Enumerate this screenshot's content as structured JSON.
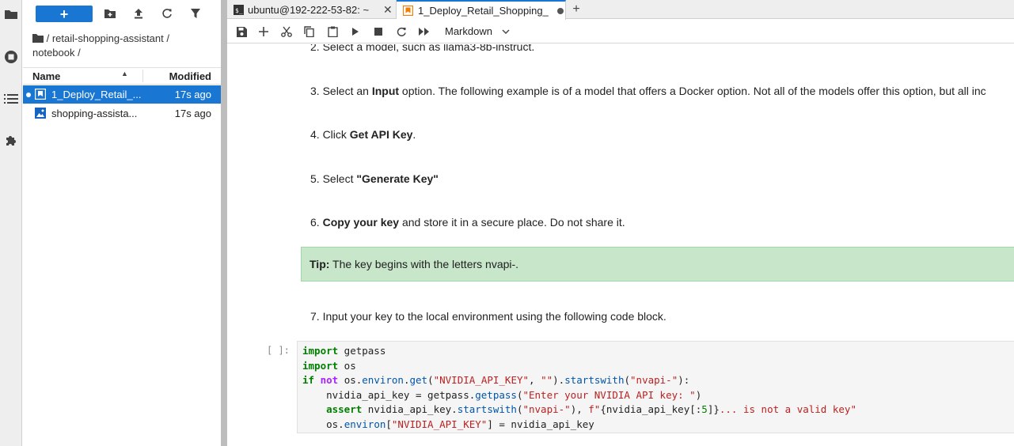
{
  "file_browser": {
    "new_button": "+",
    "breadcrumb": "/ retail-shopping-assistant / notebook /",
    "columns": {
      "name": "Name",
      "modified": "Modified"
    },
    "files": [
      {
        "name": "1_Deploy_Retail_...",
        "modified": "17s ago",
        "icon": "notebook-icon",
        "selected": true
      },
      {
        "name": "shopping-assista...",
        "modified": "17s ago",
        "icon": "image-file-icon",
        "selected": false
      }
    ]
  },
  "tabs": [
    {
      "label": "ubuntu@192-222-53-82: ~",
      "icon": "terminal-icon"
    },
    {
      "label": "1_Deploy_Retail_Shopping_",
      "icon": "notebook-icon",
      "active": true,
      "modified": true
    }
  ],
  "notebook_toolbar": {
    "cell_type": "Markdown"
  },
  "cells": {
    "step2": "2. Select a model, such as llama3-8b-instruct.",
    "step3_pre": "3. Select an ",
    "step3_bold": "Input",
    "step3_post": " option. The following example is of a model that offers a Docker option. Not all of the models offer this option, but all inc",
    "step4_pre": "4. Click ",
    "step4_bold": "Get API Key",
    "step4_post": ".",
    "step5_pre": "5. Select ",
    "step5_bold": "\"Generate Key\"",
    "step6_pre": "6. ",
    "step6_bold": "Copy your key",
    "step6_post": " and store it in a secure place. Do not share it.",
    "tip_bold": "Tip:",
    "tip_text": " The key begins with the letters nvapi-.",
    "step7": "7. Input your key to the local environment using the following code block.",
    "prompt": "[ ]:"
  },
  "colors": {
    "accent": "#1976d2",
    "tip_bg": "#c8e6c9"
  }
}
